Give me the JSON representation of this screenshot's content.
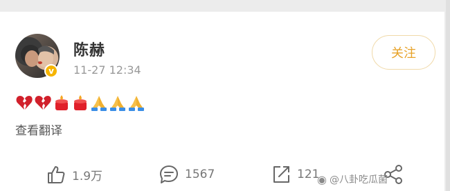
{
  "post": {
    "author_name": "陈赫",
    "timestamp": "11-27 12:34",
    "follow_label": "关注",
    "emojis": [
      "broken-heart",
      "broken-heart",
      "candle",
      "candle",
      "folded-hands",
      "folded-hands",
      "folded-hands"
    ],
    "translate_label": "查看翻译"
  },
  "toolbar": {
    "likes": "1.9万",
    "comments": "1567",
    "reposts": "121"
  },
  "watermark": {
    "text": "@八卦吃瓜菌"
  },
  "colors": {
    "accent": "#e7a228",
    "follow_border": "#f0d9a8",
    "verified": "#f5b400"
  }
}
